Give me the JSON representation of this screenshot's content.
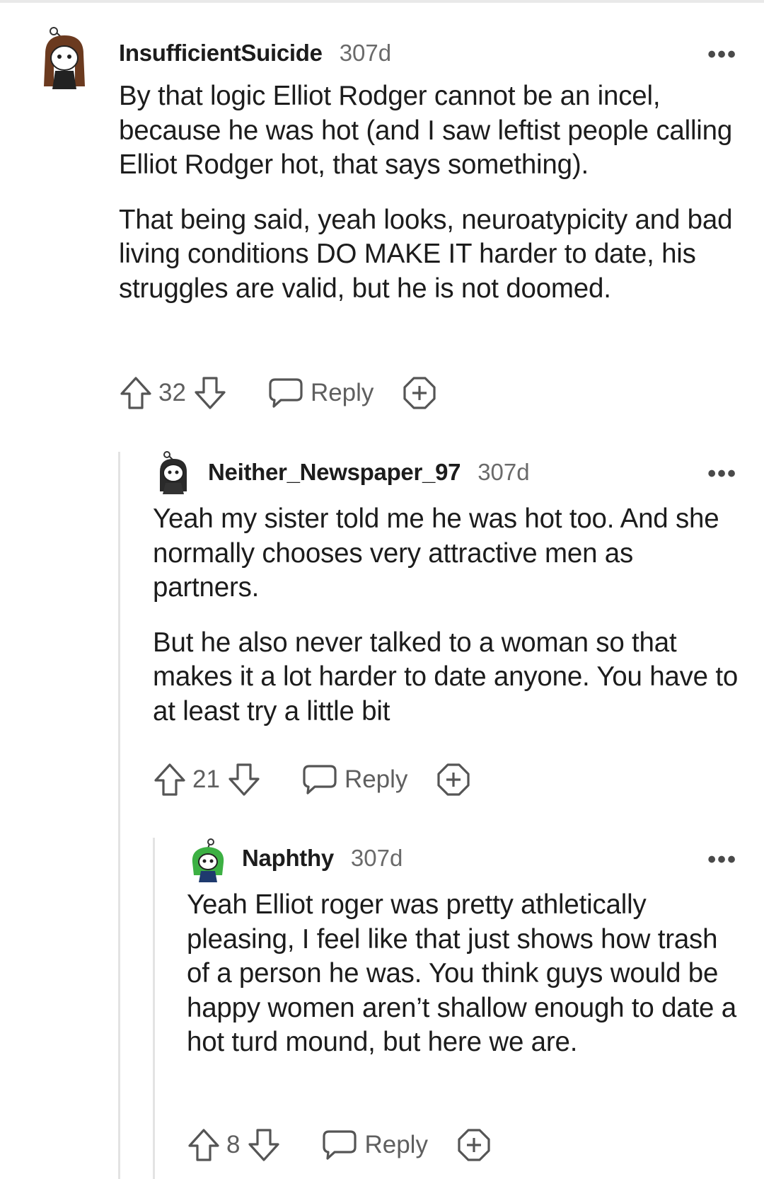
{
  "comments": [
    {
      "username": "InsufficientSuicide",
      "age": "307d",
      "paragraphs": [
        "By that logic Elliot Rodger cannot be an incel, because he was hot (and I saw leftist people calling Elliot Rodger hot, that says something).",
        "That being said, yeah looks, neuroatypicity and bad living conditions DO MAKE IT harder to date, his struggles are valid, but he is not doomed."
      ],
      "votes": "32",
      "reply_label": "Reply",
      "more": "•••",
      "avatar_icon": "snoo-avatar-brown-hair"
    },
    {
      "username": "Neither_Newspaper_97",
      "age": "307d",
      "paragraphs": [
        "Yeah my sister told me he was hot too. And she normally chooses very attractive men as partners.",
        "But he also never talked to a woman so that makes it a lot harder to date anyone. You have to at least try a little bit"
      ],
      "votes": "21",
      "reply_label": "Reply",
      "more": "•••",
      "avatar_icon": "snoo-avatar-dark"
    },
    {
      "username": "Naphthy",
      "age": "307d",
      "paragraphs": [
        "Yeah Elliot roger was pretty athletically pleasing, I feel like that just shows how trash of a person he was. You think guys would be happy women aren’t shallow enough to date a hot turd mound, but here we are."
      ],
      "votes": "8",
      "reply_label": "Reply",
      "more": "•••",
      "avatar_icon": "snoo-avatar-green-hair"
    }
  ],
  "colors": {
    "text": "#1c1c1c",
    "meta": "#6a6a6a",
    "thread_line": "#e3e3e3"
  }
}
